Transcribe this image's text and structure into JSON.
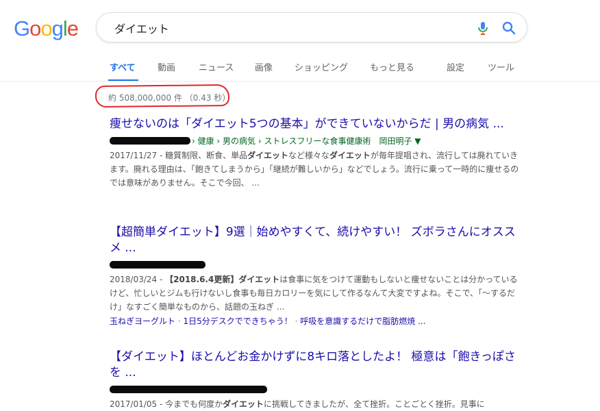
{
  "logo": {
    "text": "Google",
    "letters": [
      "G",
      "o",
      "o",
      "g",
      "l",
      "e"
    ],
    "colors": [
      "#4285f4",
      "#ea4335",
      "#fbbc05",
      "#4285f4",
      "#34a853",
      "#ea4335"
    ]
  },
  "search": {
    "query": "ダイエット"
  },
  "tabs": {
    "all": "すべて",
    "video": "動画",
    "news": "ニュース",
    "images": "画像",
    "shopping": "ショッピング",
    "more": "もっと見る",
    "settings": "設定",
    "tools": "ツール"
  },
  "stats": "約 508,000,000 件 （0.43 秒）",
  "accent_colors": {
    "active_tab": "#1a73e8",
    "link": "#1a0dab",
    "url": "#006621",
    "highlight": "#e0262b"
  },
  "results": [
    {
      "title": "痩せないのは「ダイエット5つの基本」ができていないからだ | 男の病気 ...",
      "breadcrumb": "› 健康 › 男の病気 › ストレスフリーな食事健康術　岡田明子 ▼",
      "date": "2017/11/27 - ",
      "snippet_parts": [
        "糖質制限、断食、単品",
        "ダイエット",
        "など様々な",
        "ダイエット",
        "が毎年提唱され、流行しては廃れていきます。廃れる理由は、「飽きてしまうから」「継続が難しいから」などでしょう。流行に乗って一時的に痩せるのでは意味がありません。そこで今回、 ..."
      ]
    },
    {
      "title": "【超簡単ダイエット】9選｜始めやすくて、続けやすい！ ズボラさんにオススメ ...",
      "breadcrumb": "",
      "date": "2018/03/24 - ",
      "snippet_parts": [
        "【2018.6.4更新】",
        "ダイエット",
        "は食事に気をつけて運動もしないと痩せないことは分かっているけど、忙しいとジムも行けないし食事も毎日カロリーを気にして作るなんて大変ですよね。そこで、「〜するだけ」なすごく簡単なものから、話題の玉ねぎ ..."
      ],
      "sitelinks": [
        "玉ねぎヨーグルト",
        "1日5分デスクでできちゃう！",
        "呼吸を意識するだけで脂肪燃焼 ..."
      ],
      "sitelink_sep": " · "
    },
    {
      "title": "【ダイエット】ほとんどお金かけずに8キロ落としたよ！ 極意は「飽きっぽさを ...",
      "breadcrumb": "",
      "date": "2017/01/05 - ",
      "snippet_parts": [
        "今までも何度か",
        "ダイエット",
        "に挑戦してきましたが、全て挫折。ことごとく挫折。見事に"
      ]
    }
  ]
}
